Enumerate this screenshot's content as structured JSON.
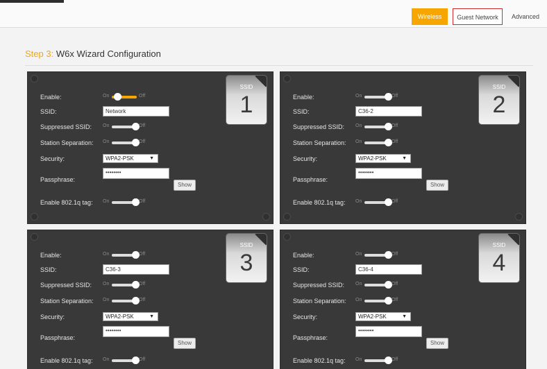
{
  "nav": {
    "wireless": "Wireless",
    "guest_network": "Guest Network",
    "advanced": "Advanced"
  },
  "step": {
    "number": "Step 3:",
    "title": "W6x Wizard Configuration"
  },
  "labels": {
    "enable": "Enable:",
    "ssid": "SSID:",
    "suppressed": "Suppressed SSID:",
    "separation": "Station Separation:",
    "security": "Security:",
    "passphrase": "Passphrase:",
    "vlan": "Enable 802.1q tag:",
    "toggle_on": "On",
    "toggle_off": "Off",
    "show": "Show",
    "badge_label": "SSID"
  },
  "cards": [
    {
      "number": "1",
      "enable": "on",
      "ssid": "Network",
      "suppressed": "off",
      "separation": "off",
      "security": "WPA2-PSK",
      "passphrase": "••••••••",
      "vlan": "off"
    },
    {
      "number": "2",
      "enable": "off",
      "ssid": "C36-2",
      "suppressed": "off",
      "separation": "off",
      "security": "WPA2-PSK",
      "passphrase": "••••••••",
      "vlan": "off"
    },
    {
      "number": "3",
      "enable": "off",
      "ssid": "C36-3",
      "suppressed": "off",
      "separation": "off",
      "security": "WPA2-PSK",
      "passphrase": "••••••••",
      "vlan": "off"
    },
    {
      "number": "4",
      "enable": "off",
      "ssid": "C36-4",
      "suppressed": "off",
      "separation": "off",
      "security": "WPA2-PSK",
      "passphrase": "••••••••",
      "vlan": "off"
    }
  ]
}
